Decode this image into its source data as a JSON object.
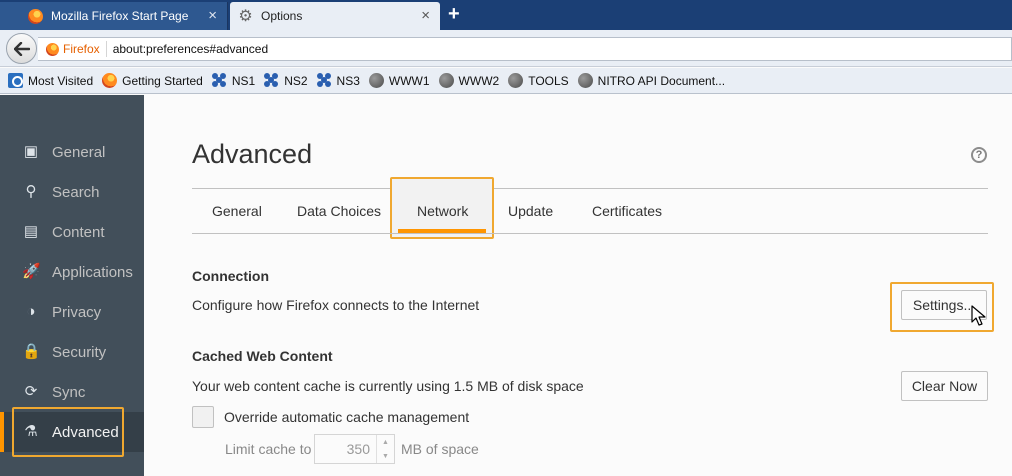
{
  "browser": {
    "tabs": [
      {
        "title": "Mozilla Firefox Start Page",
        "active": false
      },
      {
        "title": "Options",
        "active": true
      }
    ],
    "close_glyph": "×",
    "new_tab_glyph": "+",
    "back_glyph": "🡐",
    "identity_label": "Firefox",
    "url": "about:preferences#advanced",
    "bookmarks": [
      {
        "label": "Most Visited",
        "icon": "most-visited-icon"
      },
      {
        "label": "Getting Started",
        "icon": "firefox-icon"
      },
      {
        "label": "NS1",
        "icon": "ns-icon"
      },
      {
        "label": "NS2",
        "icon": "ns-icon"
      },
      {
        "label": "NS3",
        "icon": "ns-icon"
      },
      {
        "label": "WWW1",
        "icon": "globe-icon"
      },
      {
        "label": "WWW2",
        "icon": "globe-icon"
      },
      {
        "label": "TOOLS",
        "icon": "globe-icon"
      },
      {
        "label": "NITRO API Document...",
        "icon": "globe-icon"
      }
    ]
  },
  "sidebar": {
    "categories": [
      {
        "label": "General",
        "icon": "general-icon",
        "glyph": "▣"
      },
      {
        "label": "Search",
        "icon": "search-icon",
        "glyph": "⚲"
      },
      {
        "label": "Content",
        "icon": "content-icon",
        "glyph": "▤"
      },
      {
        "label": "Applications",
        "icon": "applications-icon",
        "glyph": "🚀"
      },
      {
        "label": "Privacy",
        "icon": "privacy-mask-icon",
        "glyph": "◑"
      },
      {
        "label": "Security",
        "icon": "security-lock-icon",
        "glyph": "🔒"
      },
      {
        "label": "Sync",
        "icon": "sync-icon",
        "glyph": "⟳"
      },
      {
        "label": "Advanced",
        "icon": "advanced-wizard-icon",
        "glyph": "⚗"
      }
    ],
    "selected": "Advanced"
  },
  "main": {
    "heading": "Advanced",
    "help_glyph": "?",
    "subtabs": [
      "General",
      "Data Choices",
      "Network",
      "Update",
      "Certificates"
    ],
    "selected_subtab": "Network",
    "connection": {
      "title": "Connection",
      "description": "Configure how Firefox connects to the Internet",
      "settings_button": "Settings..."
    },
    "cache": {
      "title": "Cached Web Content",
      "description": "Your web content cache is currently using 1.5 MB of disk space",
      "clear_button": "Clear Now",
      "override_label": "Override automatic cache management",
      "override_checked": false,
      "limit_label": "Limit cache to",
      "limit_value": "350",
      "limit_unit": "MB of space"
    }
  },
  "colors": {
    "accent": "#ff9500",
    "highlight": "#f0a830",
    "sidebar_bg": "#424f5a",
    "tabstrip_bg": "#1b3f75"
  }
}
